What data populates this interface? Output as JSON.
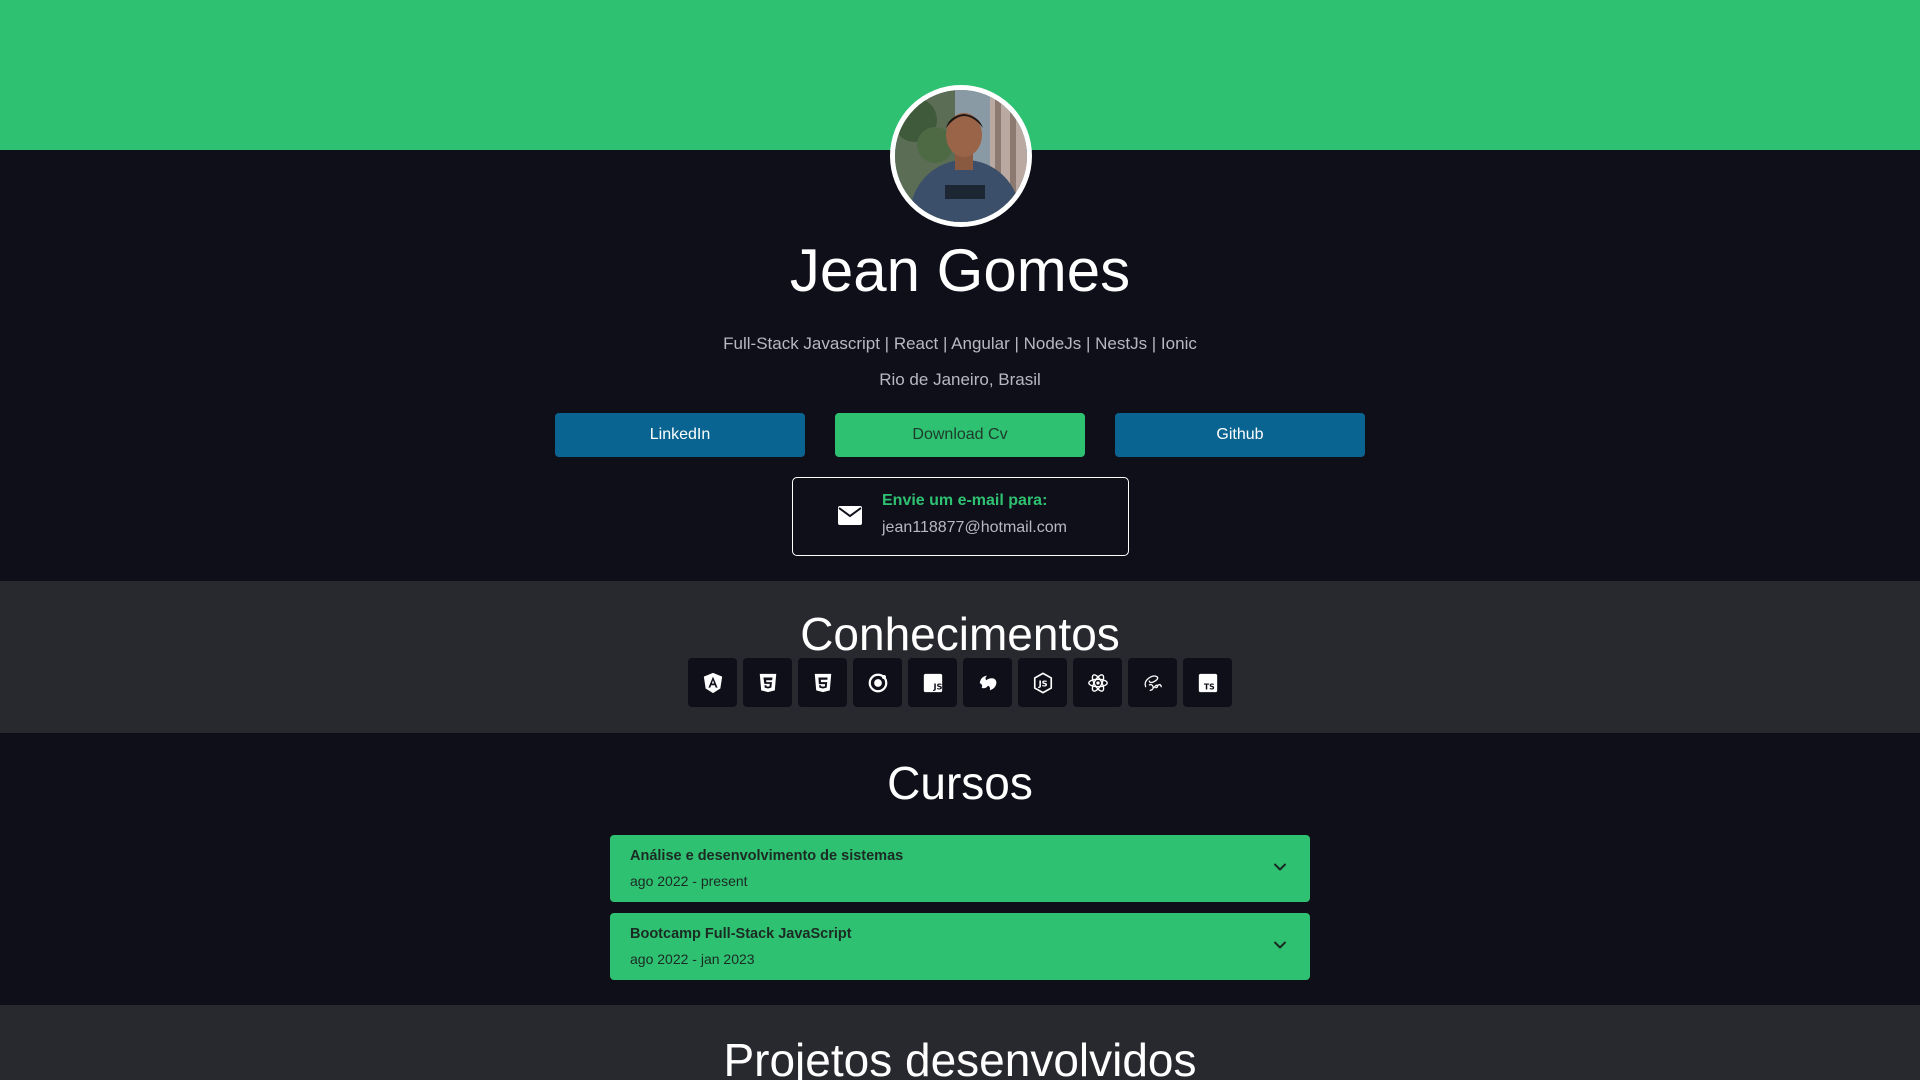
{
  "profile": {
    "name": "Jean Gomes",
    "subtitle": "Full-Stack Javascript | React | Angular | NodeJs | NestJs | Ionic",
    "location": "Rio de Janeiro, Brasil",
    "avatar": "profile-photo"
  },
  "buttons": {
    "linkedin": "LinkedIn",
    "download_cv": "Download Cv",
    "github": "Github"
  },
  "email": {
    "label": "Envie um e-mail para:",
    "address": "jean118877@hotmail.com",
    "icon": "envelope-icon"
  },
  "skills": {
    "title": "Conhecimentos",
    "items": [
      {
        "icon": "angular-icon"
      },
      {
        "icon": "css3-icon"
      },
      {
        "icon": "html5-icon"
      },
      {
        "icon": "ionic-icon"
      },
      {
        "icon": "javascript-icon"
      },
      {
        "icon": "nestjs-icon"
      },
      {
        "icon": "nodejs-icon"
      },
      {
        "icon": "react-icon"
      },
      {
        "icon": "sass-icon"
      },
      {
        "icon": "typescript-icon"
      }
    ]
  },
  "courses": {
    "title": "Cursos",
    "items": [
      {
        "title": "Análise e desenvolvimento de sistemas",
        "period": "ago 2022 - present"
      },
      {
        "title": "Bootcamp Full-Stack JavaScript",
        "period": "ago 2022 - jan 2023"
      }
    ]
  },
  "projects": {
    "title": "Projetos desenvolvidos"
  },
  "colors": {
    "accent": "#2ec171",
    "background": "#0f0f1a",
    "section_alt": "#28282f",
    "button_blue": "#0a6491"
  }
}
